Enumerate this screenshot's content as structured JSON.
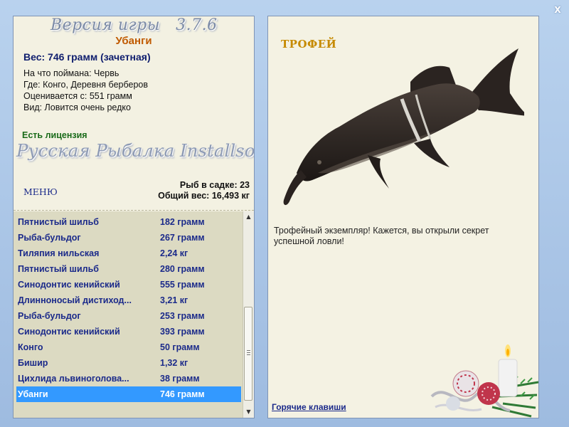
{
  "window": {
    "close_label": "X"
  },
  "info": {
    "version_label": "Версия игры",
    "version_number": "3.7.6",
    "fish_name": "Убанги",
    "weight_line": "Вес: 746 грамм (зачетная)",
    "caught_with": "На что поймана: Червь",
    "location": "Где: Конго, Деревня берберов",
    "rated_from": "Оценивается с: 551 грамм",
    "kind": "Вид: Ловится очень редко",
    "license": "Есть лицензия",
    "brand": "Русская Рыбалка Installsoft",
    "menu_label": "МЕНЮ",
    "fish_in_cage": "Рыб в садке: 23",
    "total_weight": "Общий вес: 16,493 кг"
  },
  "catch_list": [
    {
      "name": "Пятнистый шильб",
      "weight": "182 грамм"
    },
    {
      "name": "Рыба-бульдог",
      "weight": "267 грамм"
    },
    {
      "name": "Тиляпия нильская",
      "weight": "2,24 кг"
    },
    {
      "name": "Пятнистый шильб",
      "weight": "280 грамм"
    },
    {
      "name": "Синодонтис кенийский",
      "weight": "555 грамм"
    },
    {
      "name": "Длинноносый дистиход...",
      "weight": "3,21 кг"
    },
    {
      "name": "Рыба-бульдог",
      "weight": "253 грамм"
    },
    {
      "name": "Синодонтис кенийский",
      "weight": "393 грамм"
    },
    {
      "name": "Конго",
      "weight": "50 грамм"
    },
    {
      "name": "Бишир",
      "weight": "1,32 кг"
    },
    {
      "name": "Цихлида львиноголова...",
      "weight": "38 грамм"
    },
    {
      "name": "Убанги",
      "weight": "746 грамм"
    }
  ],
  "selected_index": 11,
  "scroll_icons": {
    "up": "▲",
    "down": "▼"
  },
  "trophy": {
    "title": "ТРОФЕЙ",
    "description": "Трофейный экземпляр! Кажется, вы открыли секрет успешной ловли!",
    "hotkeys_label": "Горячие клавиши"
  },
  "colors": {
    "selected_row": "#3399ff",
    "list_text": "#1b2a8a",
    "fish_name": "#c05a00",
    "trophy_title": "#c68a00",
    "license": "#1a6b1a"
  },
  "icons": {
    "close": "close-icon",
    "fish_image": "elephantnose-fish-image",
    "decoration": "christmas-decoration-image"
  }
}
